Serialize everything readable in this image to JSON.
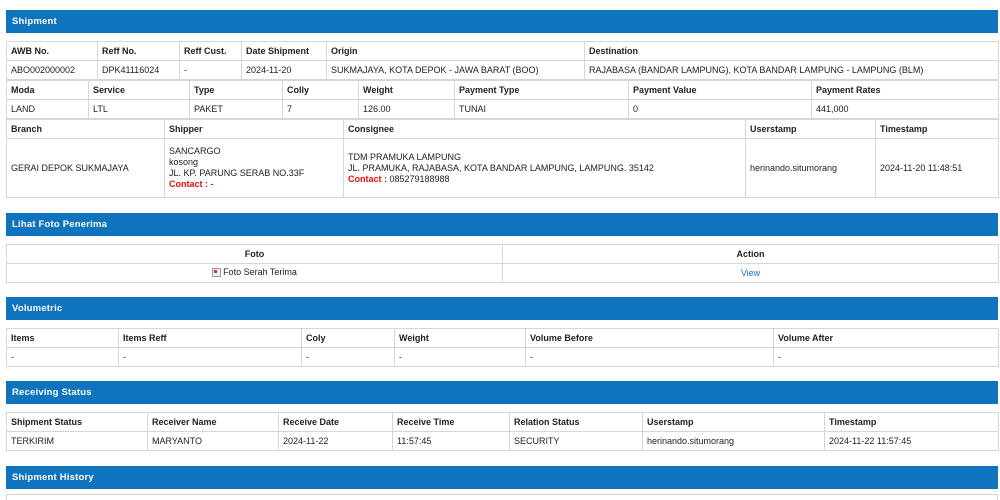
{
  "shipment": {
    "title": "Shipment",
    "row1_headers": [
      "AWB No.",
      "Reff No.",
      "Reff Cust.",
      "Date Shipment",
      "Origin",
      "Destination"
    ],
    "row1_values": [
      "ABO002000002",
      "DPK41116024",
      "-",
      "2024-11-20",
      "SUKMAJAYA, KOTA DEPOK - JAWA BARAT (BOO)",
      "RAJABASA (BANDAR LAMPUNG), KOTA BANDAR LAMPUNG - LAMPUNG (BLM)"
    ],
    "row2_headers": [
      "Moda",
      "Service",
      "Type",
      "Colly",
      "Weight",
      "Payment Type",
      "Payment Value",
      "Payment Rates"
    ],
    "row2_values": [
      "LAND",
      "LTL",
      "PAKET",
      "7",
      "126.00",
      "TUNAI",
      "0",
      "441,000"
    ],
    "row3_headers": [
      "Branch",
      "Shipper",
      "Consignee",
      "Userstamp",
      "Timestamp"
    ],
    "branch": "GERAI DEPOK SUKMAJAYA",
    "shipper": {
      "name": "SANCARGO",
      "line2": "kosong",
      "address": "JL. KP. PARUNG SERAB NO.33F",
      "contact_label": "Contact :",
      "contact_value": " -"
    },
    "consignee": {
      "name": "TDM PRAMUKA LAMPUNG",
      "address": "JL. PRAMUKA, RAJABASA, KOTA BANDAR LAMPUNG, LAMPUNG. 35142",
      "contact_label": "Contact :",
      "contact_value": " 085279188988"
    },
    "userstamp": "herinando.situmorang",
    "timestamp": "2024-11-20 11:48:51"
  },
  "photo": {
    "title": "Lihat Foto Penerima",
    "headers": [
      "Foto",
      "Action"
    ],
    "image_alt": "Foto Serah Terima",
    "action_label": "View"
  },
  "volumetric": {
    "title": "Volumetric",
    "headers": [
      "Items",
      "Items Reff",
      "Coly",
      "Weight",
      "Volume Before",
      "Volume After"
    ],
    "values": [
      "-",
      "-",
      "-",
      "-",
      "-",
      "-"
    ]
  },
  "receiving": {
    "title": "Receiving Status",
    "headers": [
      "Shipment Status",
      "Receiver Name",
      "Receive Date",
      "Receive Time",
      "Relation Status",
      "Userstamp",
      "Timestamp"
    ],
    "values": [
      "TERKIRIM",
      "MARYANTO",
      "2024-11-22",
      "11:57:45",
      "SECURITY",
      "herinando.situmorang",
      "2024-11-22 11:57:45"
    ]
  },
  "history": {
    "title": "Shipment History"
  },
  "colors": {
    "header_bg": "#0f74bd",
    "contact_red": "#e01010",
    "link_blue": "#1a73c9"
  }
}
